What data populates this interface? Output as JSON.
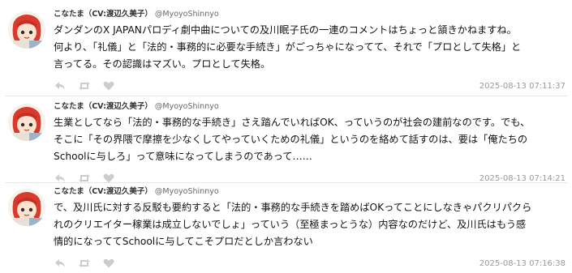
{
  "posts": [
    {
      "author": {
        "display_name": "こなたま（CV:渡辺久美子）",
        "handle": "@MyoyoShinnyo"
      },
      "lines": [
        "ダンダンのX JAPANパロディ劇中曲についての及川眠子氏の一連のコメントはちょっと頷きかねますね。",
        "何より、「礼儀」と「法的・事務的に必要な手続き」がごっちゃになってて、それで「プロとして失格」と",
        "言ってる。その認識はマズい。プロとして失格。"
      ],
      "timestamp": "2025-08-13 07:11:37"
    },
    {
      "author": {
        "display_name": "こなたま（CV:渡辺久美子）",
        "handle": "@MyoyoShinnyo"
      },
      "lines": [
        "生業としてなら「法的・事務的な手続き」さえ踏んでいればOK、っていうのが社会の建前なのです。でも、",
        "そこに「その界隈で摩擦を少なくしてやっていくための礼儀」というのを絡めて話すのは、要は「俺たちの",
        "Schoolに与しろ」って意味になってしまうのであって……"
      ],
      "timestamp": "2025-08-13 07:14:21"
    },
    {
      "author": {
        "display_name": "こなたま（CV:渡辺久美子）",
        "handle": "@MyoyoShinnyo"
      },
      "lines": [
        "で、及川氏に対する反駁も要約すると「法的・事務的な手続きを踏めばOKってことにしなきゃパクリパクら",
        "れのクリエイター稼業は成立しないでしょ」っていう（至極まっとうな）内容なのだけど、及川氏はもう感",
        "情的になっててSchoolに与してこそプロだとしか言わない"
      ],
      "timestamp": "2025-08-13 07:16:38"
    }
  ],
  "icons": {
    "reply": "reply-icon",
    "repost": "repost-icon",
    "like": "heart-icon"
  },
  "colors": {
    "text": "#111111",
    "meta": "#999999",
    "action_icon": "#cccccc",
    "divider": "#e6e6e6",
    "avatar_hair": "#d93a2b"
  }
}
